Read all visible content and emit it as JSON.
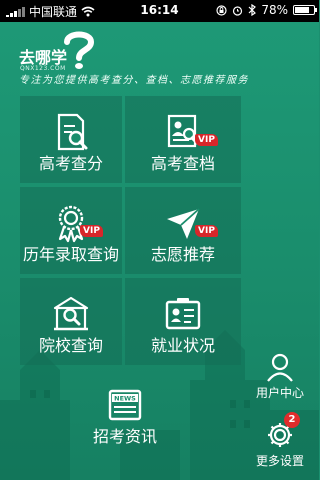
{
  "status_bar": {
    "carrier": "中国联通",
    "time": "16:14",
    "battery": "78%",
    "battery_level": 0.78
  },
  "header": {
    "logo_name": "去哪学",
    "logo_url": "QNX123.COM",
    "slogan": "专注为您提供高考查分、查档、志愿推荐服务"
  },
  "tiles": [
    {
      "label": "高考查分",
      "icon": "score-search-icon",
      "vip": ""
    },
    {
      "label": "高考查档",
      "icon": "profile-search-icon",
      "vip": "VIP"
    },
    {
      "label": "历年录取查询",
      "icon": "award-medal-icon",
      "vip": "VIP"
    },
    {
      "label": "志愿推荐",
      "icon": "paper-plane-icon",
      "vip": "VIP"
    },
    {
      "label": "院校查询",
      "icon": "school-search-icon",
      "vip": ""
    },
    {
      "label": "就业状况",
      "icon": "id-card-icon",
      "vip": ""
    },
    {
      "label": "招考资讯",
      "icon": "news-icon",
      "vip": ""
    }
  ],
  "side": {
    "user_center": "用户中心",
    "more_settings": "更多设置",
    "settings_badge": "2"
  },
  "colors": {
    "background": "#1b8f6f",
    "tile": "#146e55",
    "vip": "#d8262a",
    "badge": "#e02c2c"
  }
}
